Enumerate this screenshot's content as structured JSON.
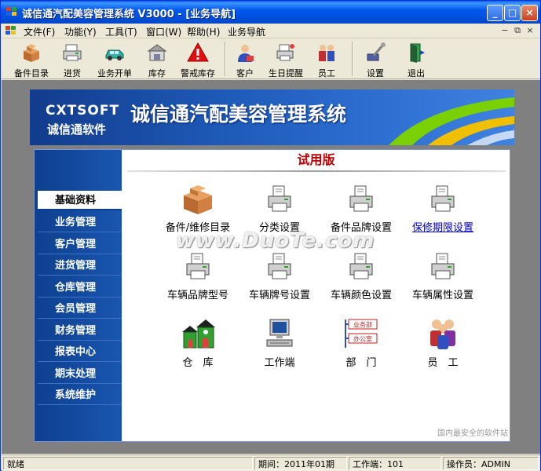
{
  "window": {
    "title": "诚信通汽配美容管理系统 V3000 - [业务导航]",
    "controls": {
      "minimize": "_",
      "maximize": "□",
      "close": "×"
    }
  },
  "menu": {
    "items": [
      "文件(F)",
      "功能(Y)",
      "工具(T)",
      "窗口(W)",
      "帮助(H)",
      "业务导航"
    ],
    "mdi_controls": [
      "−",
      "⧉",
      "×"
    ]
  },
  "toolbar": {
    "items": [
      {
        "label": "备件目录",
        "icon": "boxes-icon"
      },
      {
        "label": "进货",
        "icon": "printer-icon"
      },
      {
        "label": "业务开单",
        "icon": "car-icon"
      },
      {
        "label": "库存",
        "icon": "warehouse-icon"
      },
      {
        "label": "警戒库存",
        "icon": "warning-icon"
      },
      {
        "label": "客户",
        "icon": "customer-icon"
      },
      {
        "label": "生日提醒",
        "icon": "cake-icon"
      },
      {
        "label": "员工",
        "icon": "staff-icon"
      },
      {
        "label": "设置",
        "icon": "tools-icon"
      },
      {
        "label": "退出",
        "icon": "exit-door-icon"
      }
    ]
  },
  "banner": {
    "brand_en": "CXTSOFT",
    "brand_cn": "诚信通软件",
    "system_title": "诚信通汽配美容管理系统"
  },
  "panel": {
    "trial_label": "试用版",
    "sidebar": [
      {
        "label": "基础资料",
        "active": true
      },
      {
        "label": "业务管理"
      },
      {
        "label": "客户管理"
      },
      {
        "label": "进货管理"
      },
      {
        "label": "仓库管理"
      },
      {
        "label": "会员管理"
      },
      {
        "label": "财务管理"
      },
      {
        "label": "报表中心"
      },
      {
        "label": "期末处理"
      },
      {
        "label": "系统维护"
      }
    ],
    "grid": [
      {
        "label": "备件/维修目录",
        "icon": "boxes-icon"
      },
      {
        "label": "分类设置",
        "icon": "printer-doc-icon"
      },
      {
        "label": "备件品牌设置",
        "icon": "printer-doc-icon"
      },
      {
        "label": "保修期限设置",
        "icon": "printer-doc-icon",
        "link": true
      },
      {
        "label": "车辆品牌型号",
        "icon": "printer-doc-icon"
      },
      {
        "label": "车辆牌号设置",
        "icon": "printer-doc-icon"
      },
      {
        "label": "车辆颜色设置",
        "icon": "printer-doc-icon"
      },
      {
        "label": "车辆属性设置",
        "icon": "printer-doc-icon"
      },
      {
        "label": "仓　库",
        "icon": "warehouse-house-icon"
      },
      {
        "label": "工作端",
        "icon": "computer-icon"
      },
      {
        "label": "部　门",
        "icon": "department-icon",
        "tags": [
          "业务部",
          "办公室"
        ]
      },
      {
        "label": "员　工",
        "icon": "staff-group-icon"
      }
    ]
  },
  "watermarks": {
    "center": "www.DuoTe.com",
    "corner": "国内最安全的软件站"
  },
  "status": {
    "ready": "就绪",
    "period": "期间：2011年01期",
    "terminal": "工作端：101",
    "operator": "操作员：ADMIN"
  },
  "colors": {
    "titlebar": "#0054e3",
    "sidebar": "#1a56b0",
    "trial": "#c00000",
    "link": "#0000cc"
  }
}
